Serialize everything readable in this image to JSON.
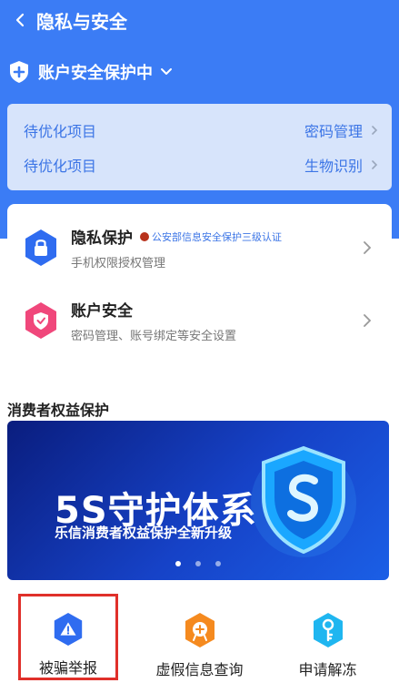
{
  "header": {
    "title": "隐私与安全"
  },
  "status": {
    "text": "账户安全保护中"
  },
  "optimize": [
    {
      "label": "待优化项目",
      "value": "密码管理"
    },
    {
      "label": "待优化项目",
      "value": "生物识别"
    }
  ],
  "settings": [
    {
      "title": "隐私保护",
      "badge": "公安部信息安全保护三级认证",
      "subtitle": "手机权限授权管理"
    },
    {
      "title": "账户安全",
      "subtitle": "密码管理、账号绑定等安全设置"
    }
  ],
  "consumer": {
    "title": "消费者权益保护",
    "banner": {
      "headline": "5S守护体系",
      "tagline": "乐信消费者权益保护全新升级",
      "page_count": 3,
      "active_page": 1
    },
    "tools": [
      {
        "label": "被骗举报"
      },
      {
        "label": "虚假信息查询"
      },
      {
        "label": "申请解冻"
      }
    ]
  },
  "colors": {
    "brand": "#3b7cf5",
    "highlight": "#e0302a",
    "link": "#3c75e6"
  }
}
